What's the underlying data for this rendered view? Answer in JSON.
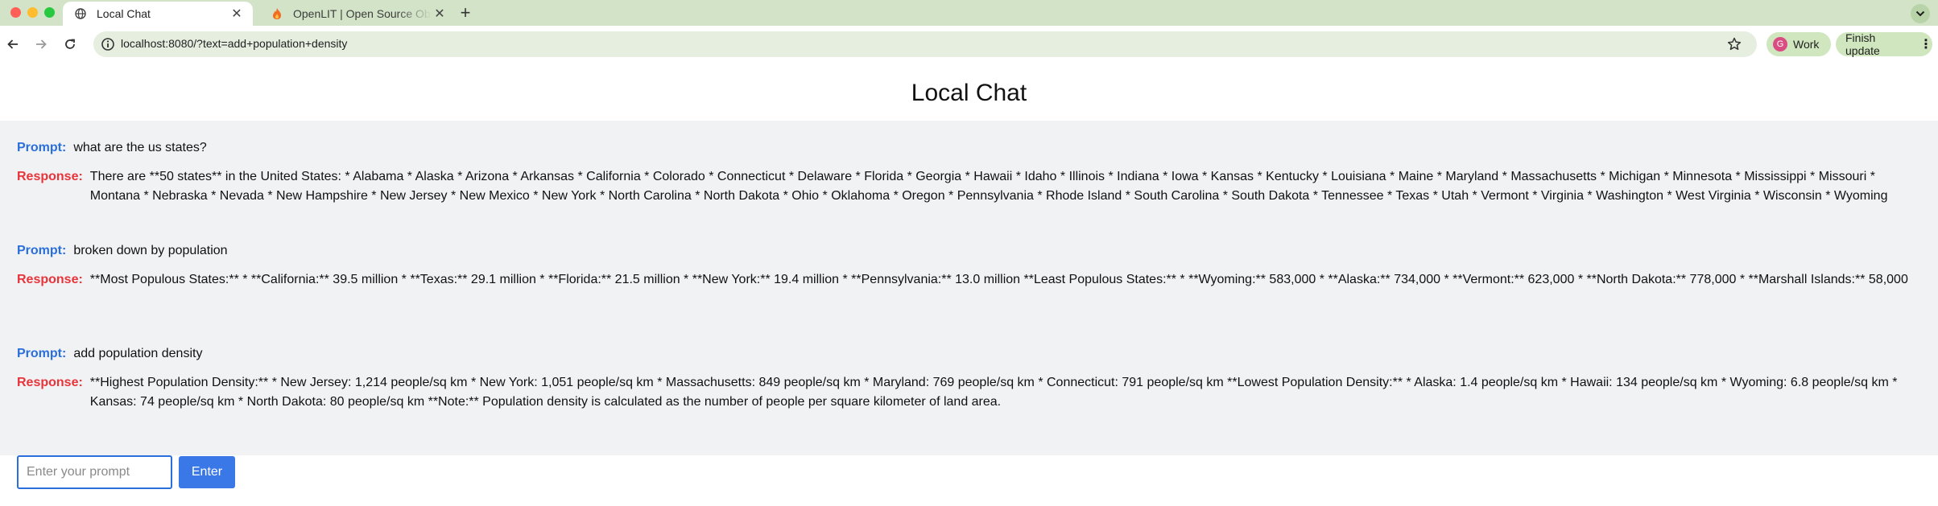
{
  "browser": {
    "tabs": [
      {
        "title": "Local Chat",
        "icon": "globe-icon",
        "active": true
      },
      {
        "title": "OpenLIT | Open Source Observability",
        "icon": "flame-icon",
        "active": false
      }
    ],
    "url": "localhost:8080/?text=add+population+density",
    "profile": {
      "initial": "G",
      "label": "Work"
    },
    "update_label": "Finish update"
  },
  "page": {
    "title": "Local Chat",
    "prompt_label": "Prompt:",
    "response_label": "Response:",
    "exchanges": [
      {
        "prompt": "what are the us states?",
        "response": "There are **50 states** in the United States: * Alabama * Alaska * Arizona * Arkansas * California * Colorado * Connecticut * Delaware * Florida * Georgia * Hawaii * Idaho * Illinois * Indiana * Iowa * Kansas * Kentucky * Louisiana * Maine * Maryland * Massachusetts * Michigan * Minnesota * Mississippi * Missouri * Montana * Nebraska * Nevada * New Hampshire * New Jersey * New Mexico * New York * North Carolina * North Dakota * Ohio * Oklahoma * Oregon * Pennsylvania * Rhode Island * South Carolina * South Dakota * Tennessee * Texas * Utah * Vermont * Virginia * Washington * West Virginia * Wisconsin * Wyoming"
      },
      {
        "prompt": "broken down by population",
        "response": "**Most Populous States:** * **California:** 39.5 million * **Texas:** 29.1 million * **Florida:** 21.5 million * **New York:** 19.4 million * **Pennsylvania:** 13.0 million **Least Populous States:** * **Wyoming:** 583,000 * **Alaska:** 734,000 * **Vermont:** 623,000 * **North Dakota:** 778,000 * **Marshall Islands:** 58,000"
      },
      {
        "prompt": "add population density",
        "response": "**Highest Population Density:** * New Jersey: 1,214 people/sq km * New York: 1,051 people/sq km * Massachusetts: 849 people/sq km * Maryland: 769 people/sq km * Connecticut: 791 people/sq km **Lowest Population Density:** * Alaska: 1.4 people/sq km * Hawaii: 134 people/sq km * Wyoming: 6.8 people/sq km * Kansas: 74 people/sq km * North Dakota: 80 people/sq km **Note:** Population density is calculated as the number of people per square kilometer of land area."
      }
    ],
    "input": {
      "value": "",
      "placeholder": "Enter your prompt"
    },
    "enter_label": "Enter"
  },
  "colors": {
    "prompt_label": "#2a6fdb",
    "response_label": "#e8343a",
    "button": "#3b78e7",
    "chat_background": "#f1f2f4",
    "tabstrip": "#d3e3c8"
  }
}
